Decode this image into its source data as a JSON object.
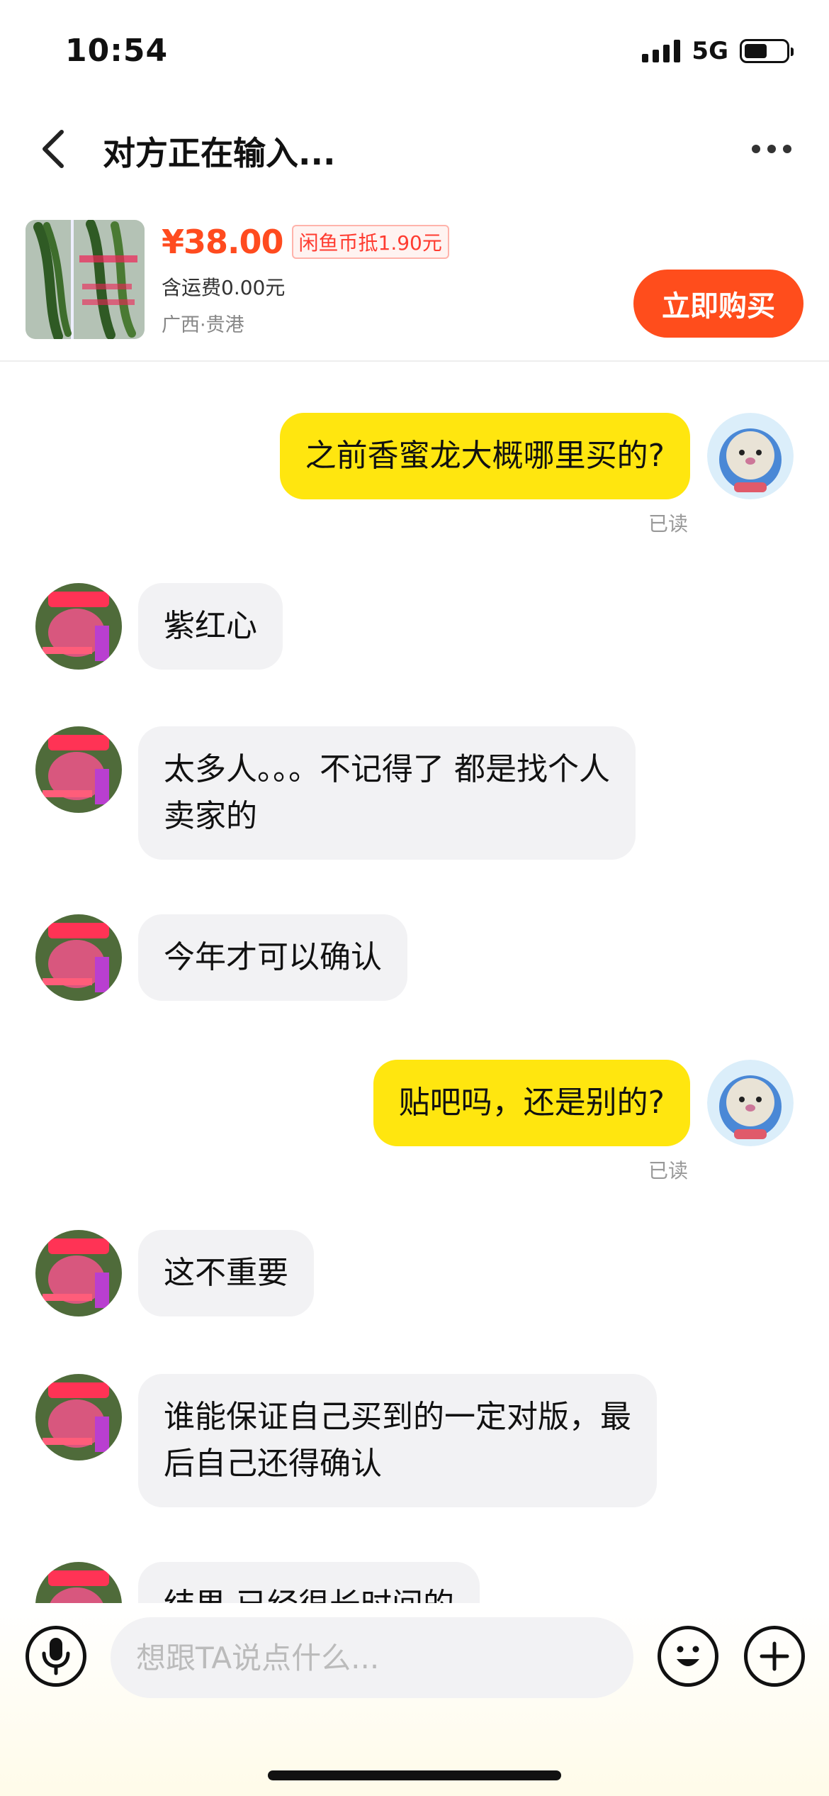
{
  "status_bar": {
    "time": "10:54",
    "network": "5G",
    "battery_level": 0.55
  },
  "header": {
    "title": "对方正在输入...",
    "back_icon": "chevron-left-icon",
    "more_icon": "more-dots-icon"
  },
  "product": {
    "price": "¥38.00",
    "coin_tag": "闲鱼币抵1.90元",
    "shipping": "含运费0.00元",
    "location": "广西·贵港",
    "buy_label": "立即购买",
    "accent_color": "#ff4d1c"
  },
  "messages": [
    {
      "sender": "me",
      "text": "之前香蜜龙大概哪里买的?",
      "status": "已读"
    },
    {
      "sender": "other",
      "text": "紫红心"
    },
    {
      "sender": "other",
      "text": "太多人。。。不记得了 都是找个人\n卖家的"
    },
    {
      "sender": "other",
      "text": "今年才可以确认"
    },
    {
      "sender": "me",
      "text": "贴吧吗，还是别的?",
      "status": "已读"
    },
    {
      "sender": "other",
      "text": "这不重要"
    },
    {
      "sender": "other",
      "text": "谁能保证自己买到的一定对版，最\n后自己还得确认"
    },
    {
      "sender": "other",
      "text": "结果 已经很长时间的"
    }
  ],
  "input": {
    "placeholder": "想跟TA说点什么..."
  },
  "colors": {
    "my_bubble": "#ffe60f",
    "other_bubble": "#f2f2f4"
  }
}
